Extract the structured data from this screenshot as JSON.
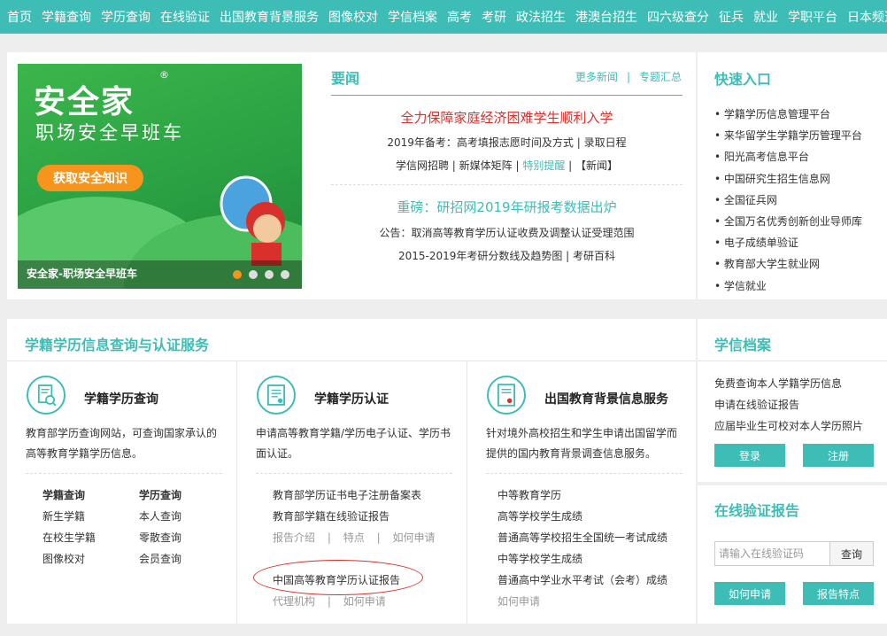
{
  "nav": [
    "首页",
    "学籍查询",
    "学历查询",
    "在线验证",
    "出国教育背景服务",
    "图像校对",
    "学信档案",
    "高考",
    "考研",
    "政法招生",
    "港澳台招生",
    "四六级查分",
    "征兵",
    "就业",
    "学职平台",
    "日本频道"
  ],
  "banner": {
    "brand": "安全家",
    "reg": "®",
    "tagline": "职场安全早班车",
    "cta": "获取安全知识",
    "caption": "安全家-职场安全早班车"
  },
  "news": {
    "title": "要闻",
    "more": "更多新闻",
    "special": "专题汇总",
    "sep": "|",
    "headline1": "全力保障家庭经济困难学生顺利入学",
    "sub1": "2019年备考：高考填报志愿时间及方式 | 录取日程",
    "sub2_a": "学信网招聘 | 新媒体矩阵 | ",
    "sub2_hot": "特别提醒",
    "sub2_b": " | 【新闻】",
    "headline2": "重磅：研招网2019年研报考数据出炉",
    "sub3": "公告：取消高等教育学历认证收费及调整认证受理范围",
    "sub4": "2015-2019年考研分数线及趋势图 | 考研百科"
  },
  "quick": {
    "title": "快速入口",
    "items": [
      "学籍学历信息管理平台",
      "来华留学生学籍学历管理平台",
      "阳光高考信息平台",
      "中国研究生招生信息网",
      "全国征兵网",
      "全国万名优秀创新创业导师库",
      "电子成绩单验证",
      "教育部大学生就业网",
      "学信就业"
    ]
  },
  "services": {
    "title": "学籍学历信息查询与认证服务",
    "col1": {
      "head": "学籍学历查询",
      "desc": "教育部学历查询网站，可查询国家承认的高等教育学籍学历信息。",
      "left_head": "学籍查询",
      "left": [
        "新生学籍",
        "在校生学籍",
        "图像校对"
      ],
      "right_head": "学历查询",
      "right": [
        "本人查询",
        "零散查询",
        "会员查询"
      ]
    },
    "col2": {
      "head": "学籍学历认证",
      "desc": "申请高等教育学籍/学历电子认证、学历书面认证。",
      "link1": "教育部学历证书电子注册备案表",
      "link2": "教育部学籍在线验证报告",
      "sub1": "报告介绍",
      "sub2": "特点",
      "sub3": "如何申请",
      "sep": "|",
      "link3": "中国高等教育学历认证报告",
      "sub4": "代理机构",
      "sub5": "如何申请"
    },
    "col3": {
      "head": "出国教育背景信息服务",
      "desc": "针对境外高校招生和学生申请出国留学而提供的国内教育背景调查信息服务。",
      "items": [
        "中等教育学历",
        "高等学校学生成绩",
        "普通高等学校招生全国统一考试成绩",
        "中等学校学生成绩",
        "普通高中学业水平考试（会考）成绩"
      ],
      "apply": "如何申请"
    }
  },
  "archive": {
    "title": "学信档案",
    "links": [
      "免费查询本人学籍学历信息",
      "申请在线验证报告",
      "应届毕业生可校对本人学历照片"
    ],
    "login": "登录",
    "register": "注册"
  },
  "verify": {
    "title": "在线验证报告",
    "placeholder": "请输入在线验证码",
    "query": "查询",
    "how": "如何申请",
    "features": "报告特点"
  },
  "colors": {
    "teal": "#3ebdb7",
    "red": "#d9302b",
    "orange": "#f7941d"
  }
}
